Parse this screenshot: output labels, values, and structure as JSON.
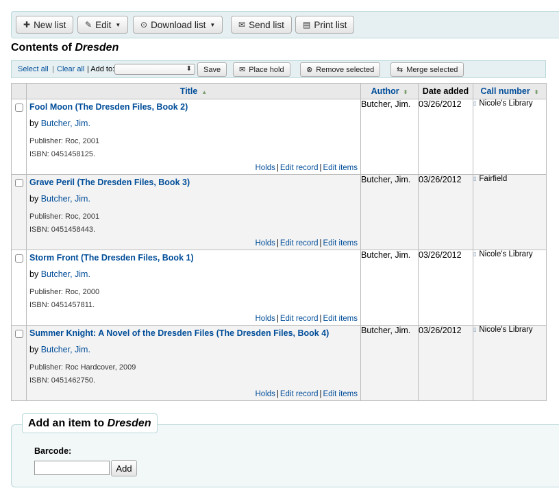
{
  "toolbar": {
    "new_list": "New list",
    "edit": "Edit",
    "download_list": "Download list",
    "send_list": "Send list",
    "print_list": "Print list"
  },
  "page": {
    "heading_prefix": "Contents of ",
    "list_name": "Dresden"
  },
  "selection": {
    "select_all": "Select all",
    "clear_all": "Clear all",
    "add_to_label": "| Add to:",
    "save": "Save",
    "place_hold": "Place hold",
    "remove_selected": "Remove selected",
    "merge_selected": "Merge selected"
  },
  "table": {
    "headers": {
      "title": "Title",
      "author": "Author",
      "date_added": "Date added",
      "call_number": "Call number"
    },
    "rows": [
      {
        "title": "Fool Moon (The Dresden Files, Book 2)",
        "by": "by ",
        "author_link": "Butcher, Jim.",
        "publisher_label": "Publisher: ",
        "publisher": "Roc, 2001",
        "isbn_label": "ISBN: ",
        "isbn": "0451458125.",
        "holds": "Holds",
        "edit_record": "Edit record",
        "edit_items": "Edit items",
        "author": "Butcher, Jim.",
        "date_added": "03/26/2012",
        "call_number": "Nicole's Library"
      },
      {
        "title": "Grave Peril (The Dresden Files, Book 3)",
        "by": "by ",
        "author_link": "Butcher, Jim.",
        "publisher_label": "Publisher: ",
        "publisher": "Roc, 2001",
        "isbn_label": "ISBN: ",
        "isbn": "0451458443.",
        "holds": "Holds",
        "edit_record": "Edit record",
        "edit_items": "Edit items",
        "author": "Butcher, Jim.",
        "date_added": "03/26/2012",
        "call_number": "Fairfield"
      },
      {
        "title": "Storm Front (The Dresden Files, Book 1)",
        "by": "by ",
        "author_link": "Butcher, Jim.",
        "publisher_label": "Publisher: ",
        "publisher": "Roc, 2000",
        "isbn_label": "ISBN: ",
        "isbn": "0451457811.",
        "holds": "Holds",
        "edit_record": "Edit record",
        "edit_items": "Edit items",
        "author": "Butcher, Jim.",
        "date_added": "03/26/2012",
        "call_number": "Nicole's Library"
      },
      {
        "title": "Summer Knight: A Novel of the Dresden Files (The Dresden Files, Book 4)",
        "by": "by ",
        "author_link": "Butcher, Jim.",
        "publisher_label": "Publisher: ",
        "publisher": "Roc Hardcover, 2009",
        "isbn_label": "ISBN: ",
        "isbn": "0451462750.",
        "holds": "Holds",
        "edit_record": "Edit record",
        "edit_items": "Edit items",
        "author": "Butcher, Jim.",
        "date_added": "03/26/2012",
        "call_number": "Nicole's Library"
      }
    ]
  },
  "add_item": {
    "legend_prefix": "Add an item to ",
    "list_name": "Dresden",
    "barcode_label": "Barcode:",
    "barcode_value": "",
    "add_button": "Add"
  }
}
